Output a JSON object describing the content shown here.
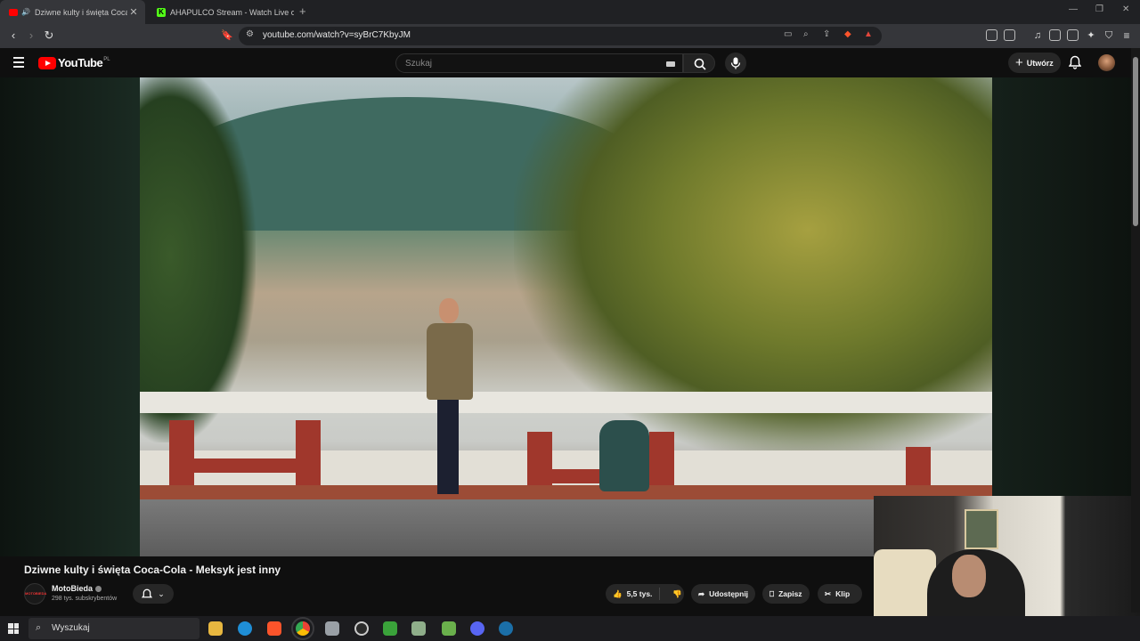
{
  "browser": {
    "tabs": [
      {
        "title": "Dziwne kulty i święta Coca-Co",
        "active": true
      },
      {
        "title": "AHAPULCO Stream - Watch Live on K",
        "active": false
      }
    ],
    "new_tab_label": "+",
    "url": "youtube.com/watch?v=syBrC7KbyJM"
  },
  "youtube": {
    "logo_text": "YouTube",
    "country_code": "PL",
    "search_placeholder": "Szukaj",
    "create_label": "Utwórz"
  },
  "video": {
    "title": "Dziwne kulty i święta Coca-Cola - Meksyk jest inny",
    "channel_name": "MotoBieda",
    "channel_avatar_text": "MOTOBIEDA",
    "subscribers": "298 tys. subskrybentów",
    "likes": "5,5 tys.",
    "share_label": "Udostępnij",
    "save_label": "Zapisz",
    "clip_label": "Klip"
  },
  "taskbar": {
    "search_placeholder": "Wyszukaj",
    "pinned_icons": [
      "file-explorer-icon",
      "edge-icon",
      "brave-icon",
      "chrome-icon",
      "app-icon",
      "obs-icon",
      "app2-icon",
      "app3-icon",
      "app4-icon",
      "discord-icon",
      "steam-icon"
    ]
  },
  "colors": {
    "brand_red": "#ff0000",
    "background": "#0f0f0f",
    "chip_bg": "#272727"
  }
}
